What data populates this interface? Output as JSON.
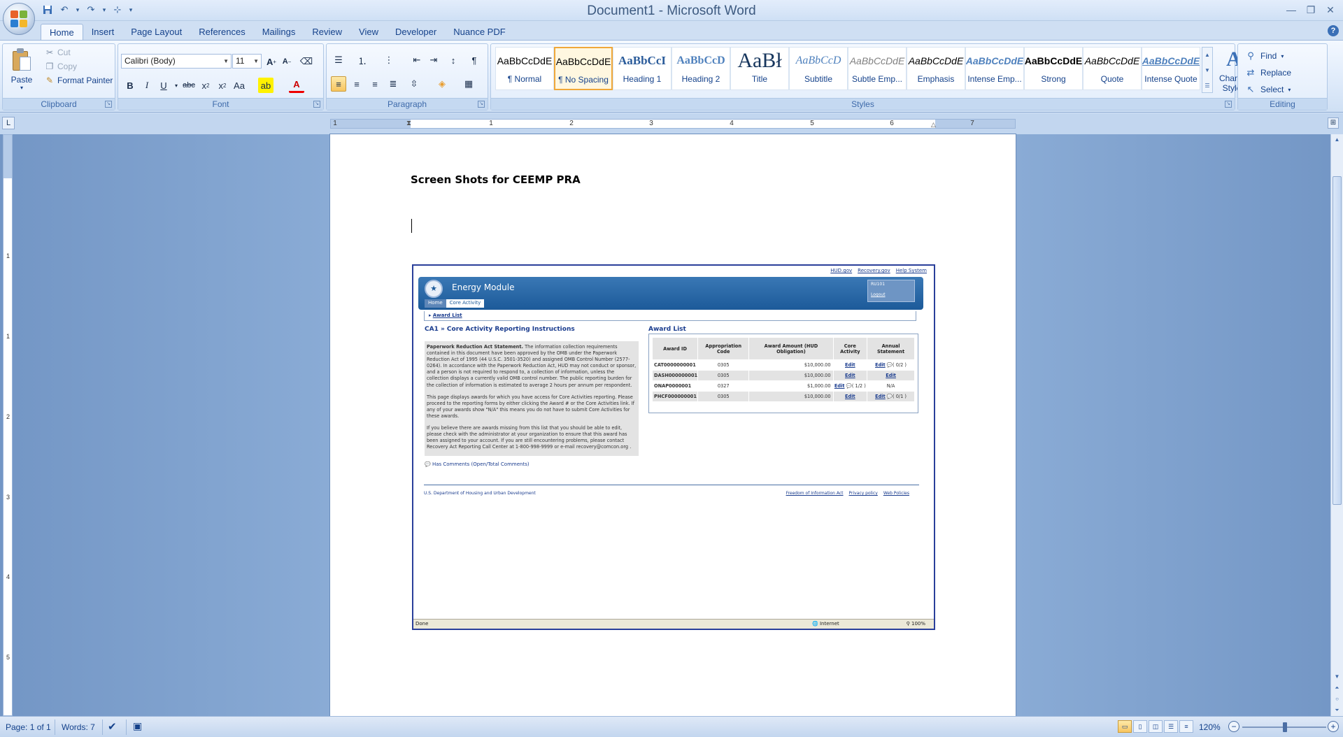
{
  "window": {
    "title": "Document1 - Microsoft Word"
  },
  "qat": {
    "save_icon": "save-icon",
    "undo_icon": "undo-icon",
    "redo_icon": "redo-icon",
    "structure_icon": "structure-icon"
  },
  "tabs": [
    {
      "label": "Home",
      "active": true
    },
    {
      "label": "Insert"
    },
    {
      "label": "Page Layout"
    },
    {
      "label": "References"
    },
    {
      "label": "Mailings"
    },
    {
      "label": "Review"
    },
    {
      "label": "View"
    },
    {
      "label": "Developer"
    },
    {
      "label": "Nuance PDF"
    }
  ],
  "clipboard": {
    "group_label": "Clipboard",
    "paste": "Paste",
    "cut": "Cut",
    "copy": "Copy",
    "format_painter": "Format Painter"
  },
  "font": {
    "group_label": "Font",
    "family": "Calibri (Body)",
    "size": "11"
  },
  "paragraph": {
    "group_label": "Paragraph"
  },
  "styles": {
    "group_label": "Styles",
    "items": [
      {
        "sample": "AaBbCcDdE",
        "label": "¶ Normal"
      },
      {
        "sample": "AaBbCcDdE",
        "label": "¶ No Spacing",
        "selected": true
      },
      {
        "sample": "AaBbCcI",
        "label": "Heading 1"
      },
      {
        "sample": "AaBbCcD",
        "label": "Heading 2"
      },
      {
        "sample": "AaBł",
        "label": "Title"
      },
      {
        "sample": "AaBbCcD",
        "label": "Subtitle"
      },
      {
        "sample": "AaBbCcDdE",
        "label": "Subtle Emp..."
      },
      {
        "sample": "AaBbCcDdE",
        "label": "Emphasis"
      },
      {
        "sample": "AaBbCcDdE",
        "label": "Intense Emp..."
      },
      {
        "sample": "AaBbCcDdE",
        "label": "Strong"
      },
      {
        "sample": "AaBbCcDdE",
        "label": "Quote"
      },
      {
        "sample": "AaBbCcDdE",
        "label": "Intense Quote"
      }
    ],
    "change_styles": "Change Styles"
  },
  "editing": {
    "group_label": "Editing",
    "find": "Find",
    "replace": "Replace",
    "select": "Select"
  },
  "ruler": {
    "h_numbers": [
      "1",
      "1",
      "2",
      "3",
      "4",
      "5",
      "6",
      "7"
    ],
    "v_numbers": [
      "1",
      "1",
      "2",
      "3",
      "4",
      "5",
      "6"
    ]
  },
  "document": {
    "heading": "Screen Shots for CEEMP PRA"
  },
  "embedded": {
    "top_links": [
      "HUD.gov",
      "Recovery.gov",
      "Help System"
    ],
    "app_title": "Energy Module",
    "nav": [
      "Home",
      "Core Activity"
    ],
    "user": {
      "name": "RU101",
      "logout": "Logout"
    },
    "crumb": "Award List",
    "heading": "CA1 » Core Activity Reporting Instructions",
    "pra_bold": "Paperwork Reduction Act Statement.",
    "pra_text": " The information collection requirements contained in this document have been approved by the OMB under the Paperwork Reduction Act of 1995 (44 U.S.C. 3501-3520) and assigned OMB Control Number (2577-0264). In accordance with the Paperwork Reduction Act, HUD may not conduct or sponsor, and a person is not required to respond to, a collection of information, unless the collection displays a currently valid OMB control number. The public reporting burden for the collection of information is estimated to average 2 hours per annum per respondent.",
    "para2": "This page displays awards for which you have access for Core Activities reporting. Please proceed to the reporting forms by either clicking the Award # or the Core Activities link. If any of your awards show \"N/A\" this means you do not have to submit Core Activities for these awards.",
    "para3": "If you believe there are awards missing from this list that you should be able to edit, please check with the administrator at your organization to ensure that this award has been assigned to your account. If you are still encountering problems, please contact Recovery Act Reporting Call Center at 1-800-998-9999 or e-mail recovery@comcon.org .",
    "comments_note": "Has Comments (Open/Total Comments)",
    "award_list_title": "Award List",
    "table": {
      "headers": [
        "Award ID",
        "Appropriation Code",
        "Award Amount (HUD Obligation)",
        "Core Activity",
        "Annual Statement"
      ],
      "rows": [
        {
          "id": "CAT0000000001",
          "code": "0305",
          "amount": "$10,000.00",
          "core": "Edit",
          "core_extra": "",
          "annual": "Edit",
          "annual_extra": "( 0/2 )"
        },
        {
          "id": "DASH000000001",
          "code": "0305",
          "amount": "$10,000.00",
          "core": "Edit",
          "core_extra": "",
          "annual": "Edit",
          "annual_extra": ""
        },
        {
          "id": "ONAP0000001",
          "code": "0327",
          "amount": "$1,000.00",
          "core": "Edit",
          "core_extra": "( 1/2 )",
          "annual": "N/A",
          "annual_extra": ""
        },
        {
          "id": "PHCF000000001",
          "code": "0305",
          "amount": "$10,000.00",
          "core": "Edit",
          "core_extra": "",
          "annual": "Edit",
          "annual_extra": "( 0/1 )"
        }
      ]
    },
    "footer_left": "U.S. Department of Housing and Urban Development",
    "footer_links": [
      "Freedom of Information Act",
      "Privacy policy",
      "Web Policies"
    ],
    "status": {
      "left": "Done",
      "zone": "Internet",
      "zoom": "100%"
    }
  },
  "statusbar": {
    "page": "Page: 1 of 1",
    "words": "Words: 7",
    "zoom": "120%"
  }
}
